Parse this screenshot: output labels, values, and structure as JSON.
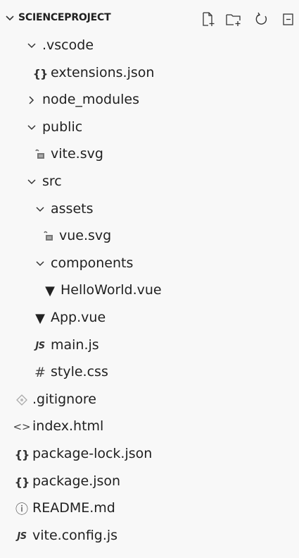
{
  "explorer": {
    "title": "SCIENCEPROJECT",
    "actions": [
      {
        "name": "new-file-icon"
      },
      {
        "name": "new-folder-icon"
      },
      {
        "name": "refresh-icon"
      },
      {
        "name": "collapse-all-icon"
      }
    ]
  },
  "tree": [
    {
      "label": ".vscode",
      "type": "folder",
      "expanded": true,
      "icon": "chevron-down-icon"
    },
    {
      "label": "extensions.json",
      "type": "file",
      "icon": "json-braces-icon",
      "glyph": "{}"
    },
    {
      "label": "node_modules",
      "type": "folder",
      "expanded": false,
      "icon": "chevron-right-icon"
    },
    {
      "label": "public",
      "type": "folder",
      "expanded": true,
      "icon": "chevron-down-icon"
    },
    {
      "label": "vite.svg",
      "type": "file",
      "icon": "svg-image-icon"
    },
    {
      "label": "src",
      "type": "folder",
      "expanded": true,
      "icon": "chevron-down-icon"
    },
    {
      "label": "assets",
      "type": "folder",
      "expanded": true,
      "icon": "chevron-down-icon"
    },
    {
      "label": "vue.svg",
      "type": "file",
      "icon": "svg-image-icon"
    },
    {
      "label": "components",
      "type": "folder",
      "expanded": true,
      "icon": "chevron-down-icon"
    },
    {
      "label": "HelloWorld.vue",
      "type": "file",
      "icon": "vue-icon",
      "glyph": "▼"
    },
    {
      "label": "App.vue",
      "type": "file",
      "icon": "vue-icon",
      "glyph": "▼"
    },
    {
      "label": "main.js",
      "type": "file",
      "icon": "js-icon",
      "glyph": "JS"
    },
    {
      "label": "style.css",
      "type": "file",
      "icon": "css-hash-icon",
      "glyph": "#"
    },
    {
      "label": ".gitignore",
      "type": "file",
      "icon": "gitignore-icon"
    },
    {
      "label": "index.html",
      "type": "file",
      "icon": "html-code-icon",
      "glyph": "<>"
    },
    {
      "label": "package-lock.json",
      "type": "file",
      "icon": "json-braces-icon",
      "glyph": "{}"
    },
    {
      "label": "package.json",
      "type": "file",
      "icon": "json-braces-icon",
      "glyph": "{}"
    },
    {
      "label": "README.md",
      "type": "file",
      "icon": "info-icon",
      "glyph": "ⓘ"
    },
    {
      "label": "vite.config.js",
      "type": "file",
      "icon": "js-icon",
      "glyph": "JS"
    }
  ]
}
